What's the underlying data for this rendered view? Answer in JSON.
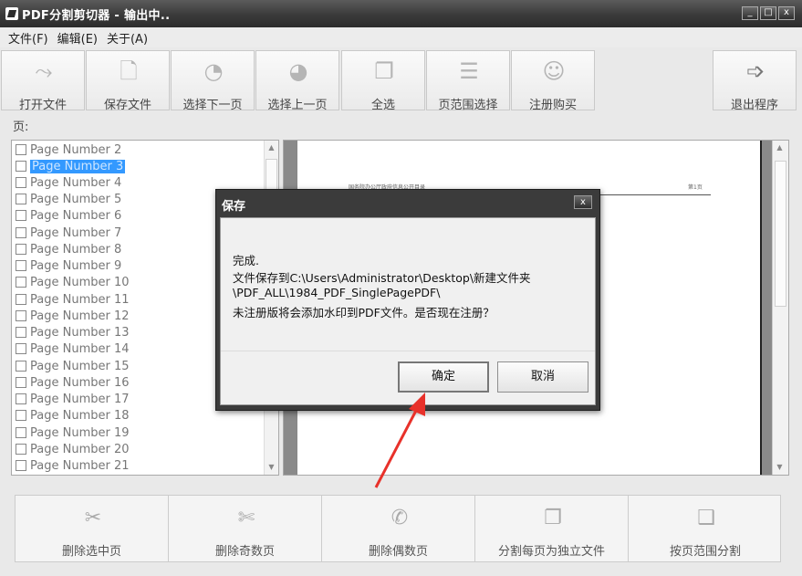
{
  "window": {
    "title": "PDF分割剪切器 - 输出中.."
  },
  "window_buttons": [
    "_",
    "□",
    "x"
  ],
  "menu": {
    "items": [
      "文件(F)",
      "编辑(E)",
      "关于(A)"
    ]
  },
  "toolbar": {
    "buttons": [
      {
        "label": "打开文件",
        "icon": "open-file-icon"
      },
      {
        "label": "保存文件",
        "icon": "save-file-icon"
      },
      {
        "label": "选择下一页",
        "icon": "select-next-page-icon"
      },
      {
        "label": "选择上一页",
        "icon": "select-prev-page-icon"
      },
      {
        "label": "全选",
        "icon": "select-all-icon"
      },
      {
        "label": "页范围选择",
        "icon": "page-range-icon"
      },
      {
        "label": "注册购买",
        "icon": "register-icon"
      },
      {
        "label": "退出程序",
        "icon": "exit-icon"
      }
    ]
  },
  "pages": {
    "caption": "页:",
    "items": [
      {
        "label": "Page Number 2",
        "selected": false
      },
      {
        "label": "Page Number 3",
        "selected": true
      },
      {
        "label": "Page Number 4",
        "selected": false
      },
      {
        "label": "Page Number 5",
        "selected": false
      },
      {
        "label": "Page Number 6",
        "selected": false
      },
      {
        "label": "Page Number 7",
        "selected": false
      },
      {
        "label": "Page Number 8",
        "selected": false
      },
      {
        "label": "Page Number 9",
        "selected": false
      },
      {
        "label": "Page Number 10",
        "selected": false
      },
      {
        "label": "Page Number 11",
        "selected": false
      },
      {
        "label": "Page Number 12",
        "selected": false
      },
      {
        "label": "Page Number 13",
        "selected": false
      },
      {
        "label": "Page Number 14",
        "selected": false
      },
      {
        "label": "Page Number 15",
        "selected": false
      },
      {
        "label": "Page Number 16",
        "selected": false
      },
      {
        "label": "Page Number 17",
        "selected": false
      },
      {
        "label": "Page Number 18",
        "selected": false
      },
      {
        "label": "Page Number 19",
        "selected": false
      },
      {
        "label": "Page Number 20",
        "selected": false
      },
      {
        "label": "Page Number 21",
        "selected": false
      }
    ]
  },
  "preview": {
    "header_text": "国务院办公厅政府信息公开目录",
    "page_text": "第1页"
  },
  "dialog": {
    "title": "保存",
    "close": "x",
    "lines": [
      "完成.",
      "文件保存到C:\\Users\\Administrator\\Desktop\\新建文件夹",
      "\\PDF_ALL\\1984_PDF_SinglePagePDF\\",
      "未注册版将会添加水印到PDF文件。是否现在注册？"
    ],
    "ok_label": "确定",
    "cancel_label": "取消"
  },
  "annotation": {
    "arrow_color": "#e8312a"
  },
  "bottom_actions": [
    {
      "label": "删除选中页",
      "icon": "delete-selected-icon"
    },
    {
      "label": "删除奇数页",
      "icon": "delete-odd-icon"
    },
    {
      "label": "删除偶数页",
      "icon": "delete-even-icon"
    },
    {
      "label": "分割每页为独立文件",
      "icon": "split-each-icon"
    },
    {
      "label": "按页范围分割",
      "icon": "split-range-icon"
    }
  ],
  "colors": {
    "title_bar": "#3a3a3a",
    "selection": "#3399ff",
    "dialog_frame": "#3b3b3b"
  }
}
